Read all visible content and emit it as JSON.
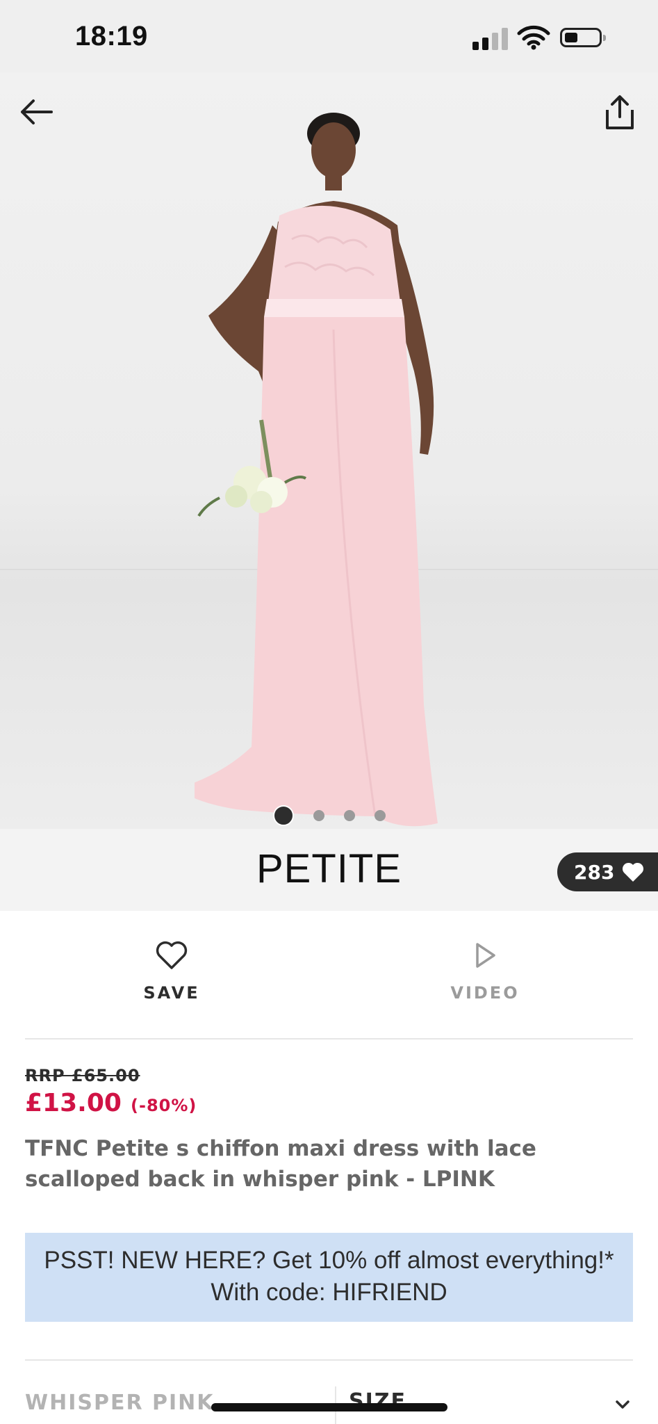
{
  "status_bar": {
    "time": "18:19"
  },
  "gallery": {
    "image_count": 4,
    "active_index": 0
  },
  "banner": {
    "label": "PETITE",
    "saves_count": "283"
  },
  "actions": {
    "save_label": "SAVE",
    "video_label": "VIDEO"
  },
  "product": {
    "rrp": "RRP £65.00",
    "price": "£13.00",
    "discount": "(-80%)",
    "title": "TFNC Petite s chiffon maxi dress with lace scalloped back in whisper pink  - LPINK"
  },
  "promo": {
    "line1": "PSST! NEW HERE? Get 10% off almost everything!*",
    "line2": "With code: HIFRIEND"
  },
  "selectors": {
    "colour": "WHISPER PINK",
    "size_label": "SIZE"
  },
  "colors": {
    "sale_red": "#d01345",
    "promo_blue": "#cfe0f5",
    "text_dark": "#2d2d2d"
  }
}
